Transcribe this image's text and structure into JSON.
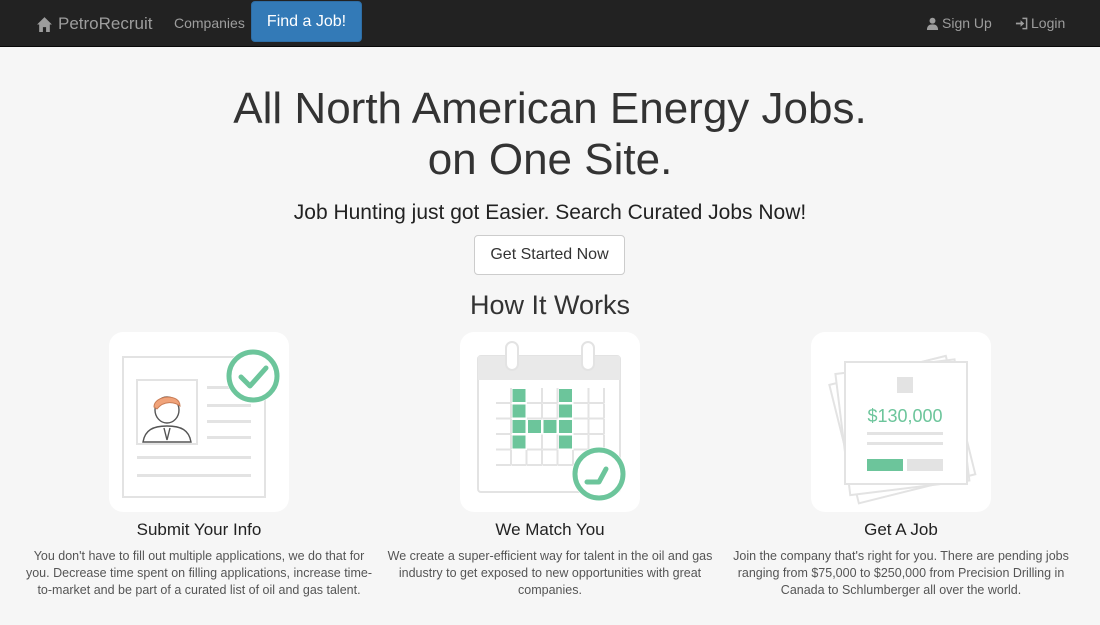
{
  "nav": {
    "brand": "PetroRecruit",
    "companies": "Companies",
    "find_job": "Find a Job!",
    "sign_up": "Sign Up",
    "login": "Login"
  },
  "hero": {
    "title_line1": "All North American Energy Jobs.",
    "title_line2": "on One Site.",
    "subtitle": "Job Hunting just got Easier. Search Curated Jobs Now!",
    "cta": "Get Started Now"
  },
  "how": {
    "title": "How It Works",
    "steps": [
      {
        "title": "Submit Your Info",
        "desc": "You don't have to fill out multiple applications, we do that for you. Decrease time spent on filling applications, increase time-to-market and be part of a curated list of oil and gas talent."
      },
      {
        "title": "We Match You",
        "desc": "We create a super-efficient way for talent in the oil and gas industry to get exposed to new opportunities with great companies."
      },
      {
        "title": "Get A Job",
        "desc": "Join the company that's right for you. There are pending jobs ranging from $75,000 to $250,000 from Precision Drilling in Canada to Schlumberger all over the world.",
        "salary": "$130,000"
      }
    ]
  },
  "colors": {
    "accent_green": "#6cc59b",
    "primary_blue": "#337ab7",
    "navbar": "#222222"
  }
}
